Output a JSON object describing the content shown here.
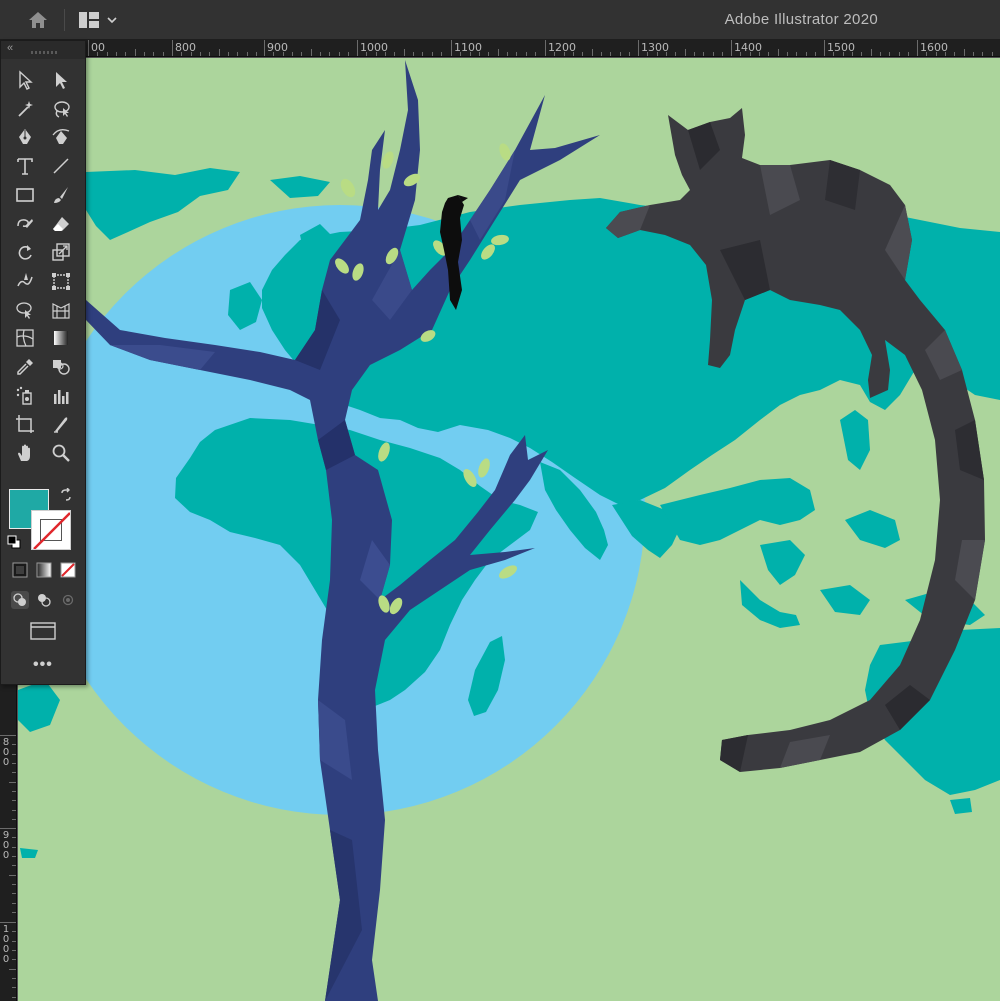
{
  "app": {
    "title": "Adobe Illustrator 2020"
  },
  "appbar": {
    "icons": [
      "home-icon",
      "workspace-layout-icon",
      "chevron-down-icon"
    ]
  },
  "rulers": {
    "top_labels": [
      "00",
      "800",
      "900",
      "1000",
      "1100",
      "1200",
      "1300",
      "1400",
      "1500",
      "1600"
    ],
    "left_labels": [
      "800",
      "900",
      "1000"
    ]
  },
  "tools_panel": {
    "collapse_label": "«",
    "tools": [
      "selection-tool-icon",
      "direct-selection-tool-icon",
      "magic-wand-tool-icon",
      "lasso-tool-icon",
      "pen-tool-icon",
      "curvature-tool-icon",
      "type-tool-icon",
      "line-segment-tool-icon",
      "rectangle-tool-icon",
      "paintbrush-tool-icon",
      "shaper-tool-icon",
      "eraser-tool-icon",
      "rotate-tool-icon",
      "scale-tool-icon",
      "warp-tool-icon",
      "free-transform-tool-icon",
      "shape-builder-tool-icon",
      "perspective-grid-tool-icon",
      "mesh-tool-icon",
      "gradient-tool-icon",
      "eyedropper-tool-icon",
      "blend-tool-icon",
      "symbol-sprayer-tool-icon",
      "column-graph-tool-icon",
      "artboard-tool-icon",
      "slice-tool-icon",
      "hand-tool-icon",
      "zoom-tool-icon"
    ],
    "fill_color": "#1fa9a5",
    "stroke_color": "none",
    "more_label": "•••"
  },
  "artwork": {
    "background_color": "#acd59c",
    "ocean_circle_color": "#72cdf1",
    "land_color": "#00b1ab",
    "tree_color": "#2f3f7e",
    "cat_color": "#3a3a3f",
    "bird_color": "#0d0d0d",
    "leaf_color": "#b9dc84"
  }
}
